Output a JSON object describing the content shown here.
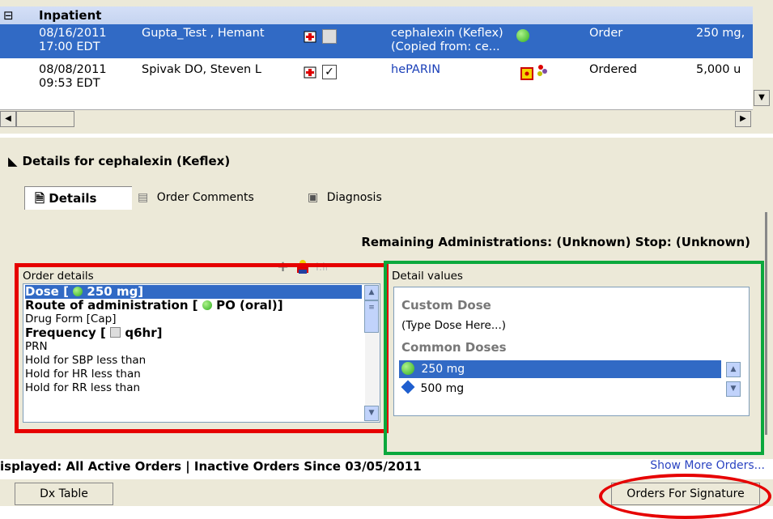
{
  "grid": {
    "group_symbol": "⊟",
    "group_label": "Inpatient",
    "rows": [
      {
        "date": "08/16/2011",
        "time": "17:00 EDT",
        "patient": "Gupta_Test , Hemant",
        "med": "cephalexin (Keflex)",
        "med_sub": "(Copied from: ce...",
        "status": "Order",
        "dose": "250 mg,"
      },
      {
        "date": "08/08/2011",
        "time": "09:53 EDT",
        "patient": "Spivak DO, Steven L",
        "med": "hePARIN",
        "status": "Ordered",
        "dose": "5,000 u"
      }
    ]
  },
  "details": {
    "header": "Details for cephalexin (Keflex)",
    "tabs": [
      {
        "label": "Details"
      },
      {
        "label": "Order Comments"
      },
      {
        "label": "Diagnosis"
      }
    ],
    "remaining": "Remaining Administrations: (Unknown)  Stop: (Unknown)",
    "order_details_label": "Order details",
    "order_items": [
      {
        "text": "Dose  [",
        "value": "250 mg]",
        "icon": "green-dot"
      },
      {
        "text": "Route of administration   [",
        "value": "PO (oral)]",
        "icon": "green-dot"
      },
      {
        "text": "Drug Form  [Cap]"
      },
      {
        "text": "Frequency   [",
        "value": "q6hr]",
        "icon": "grey-square"
      },
      {
        "text": "PRN"
      },
      {
        "text": "Hold for SBP less than"
      },
      {
        "text": "Hold for HR less than"
      },
      {
        "text": "Hold for RR less than"
      }
    ],
    "detail_values_label": "Detail values",
    "custom_dose_header": "Custom Dose",
    "custom_dose_hint": "(Type Dose Here...)",
    "common_doses_header": "Common Doses",
    "doses": [
      {
        "label": "250 mg",
        "icon": "green-dot"
      },
      {
        "label": "500 mg",
        "icon": "blue-diamond"
      }
    ]
  },
  "footer": {
    "displayed": "isplayed: All Active Orders  |  Inactive Orders Since 03/05/2011",
    "show_more": "Show More Orders...",
    "dx_table": "Dx Table",
    "orders_for_signature": "Orders For Signature"
  },
  "colors": {
    "selection": "#316ac5",
    "annotation_red": "#e60000",
    "annotation_green": "#0aa83c"
  }
}
